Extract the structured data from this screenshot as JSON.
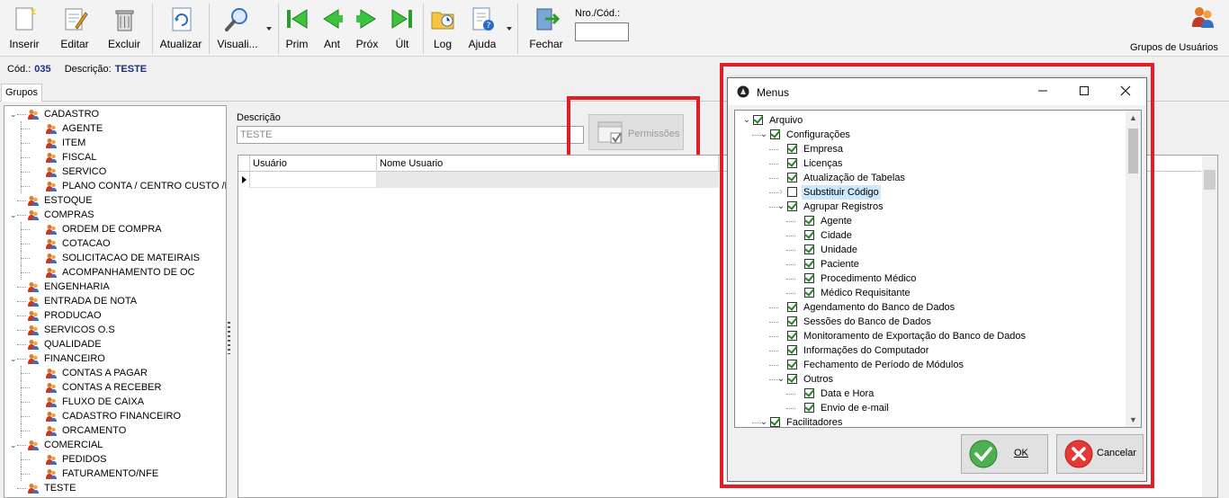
{
  "toolbar": {
    "buttons": [
      {
        "label": "Inserir",
        "icon": "new-document-icon"
      },
      {
        "label": "Editar",
        "icon": "edit-document-icon"
      },
      {
        "label": "Excluir",
        "icon": "trash-icon"
      },
      {
        "label": "Atualizar",
        "icon": "refresh-icon"
      },
      {
        "label": "Visuali...",
        "icon": "magnifier-icon"
      },
      {
        "label": "Prim",
        "icon": "first-icon"
      },
      {
        "label": "Ant",
        "icon": "previous-icon"
      },
      {
        "label": "Próx",
        "icon": "next-icon"
      },
      {
        "label": "Últ",
        "icon": "last-icon"
      },
      {
        "label": "Log",
        "icon": "log-folder-icon"
      },
      {
        "label": "Ajuda",
        "icon": "help-icon"
      },
      {
        "label": "Fechar",
        "icon": "exit-door-icon"
      }
    ],
    "nro_label": "Nro./Cód.:",
    "nro_value": "",
    "grupos_usuarios": "Grupos de Usuários"
  },
  "record": {
    "cod_label": "Cód.:",
    "cod_value": "035",
    "desc_label": "Descrição:",
    "desc_value": "TESTE"
  },
  "tab": "Grupos",
  "tree": [
    {
      "label": "CADASTRO",
      "level": 0,
      "expanded": true
    },
    {
      "label": "AGENTE",
      "level": 1
    },
    {
      "label": "ITEM",
      "level": 1
    },
    {
      "label": "FISCAL",
      "level": 1
    },
    {
      "label": "SERVICO",
      "level": 1
    },
    {
      "label": "PLANO CONTA / CENTRO CUSTO /DEF",
      "level": 1
    },
    {
      "label": "ESTOQUE",
      "level": 0
    },
    {
      "label": "COMPRAS",
      "level": 0,
      "expanded": true
    },
    {
      "label": "ORDEM DE COMPRA",
      "level": 1
    },
    {
      "label": "COTACAO",
      "level": 1
    },
    {
      "label": "SOLICITACAO DE MATEIRAIS",
      "level": 1
    },
    {
      "label": "ACOMPANHAMENTO DE OC",
      "level": 1
    },
    {
      "label": "ENGENHARIA",
      "level": 0
    },
    {
      "label": "ENTRADA DE NOTA",
      "level": 0
    },
    {
      "label": "PRODUCAO",
      "level": 0
    },
    {
      "label": "SERVICOS O.S",
      "level": 0
    },
    {
      "label": "QUALIDADE",
      "level": 0
    },
    {
      "label": "FINANCEIRO",
      "level": 0,
      "expanded": true
    },
    {
      "label": "CONTAS A PAGAR",
      "level": 1
    },
    {
      "label": "CONTAS A RECEBER",
      "level": 1
    },
    {
      "label": "FLUXO DE CAIXA",
      "level": 1
    },
    {
      "label": "CADASTRO FINANCEIRO",
      "level": 1
    },
    {
      "label": "ORCAMENTO",
      "level": 1
    },
    {
      "label": "COMERCIAL",
      "level": 0,
      "expanded": true
    },
    {
      "label": "PEDIDOS",
      "level": 1
    },
    {
      "label": "FATURAMENTO/NFE",
      "level": 1
    },
    {
      "label": "TESTE",
      "level": 0
    }
  ],
  "form": {
    "descricao_label": "Descrição",
    "descricao_value": "TESTE",
    "permissoes_label": "Permissões"
  },
  "grid": {
    "columns": [
      "Usuário",
      "Nome Usuario"
    ]
  },
  "modal": {
    "title": "Menus",
    "ok_label": "OK",
    "cancel_label": "Cancelar",
    "items": [
      {
        "label": "Arquivo",
        "level": 0,
        "exp": "v",
        "checked": true
      },
      {
        "label": "Configurações",
        "level": 1,
        "exp": "v",
        "checked": true
      },
      {
        "label": "Empresa",
        "level": 2,
        "checked": true
      },
      {
        "label": "Licenças",
        "level": 2,
        "checked": true
      },
      {
        "label": "Atualização de Tabelas",
        "level": 2,
        "checked": true
      },
      {
        "label": "Substituir Código",
        "level": 2,
        "exp": ">",
        "checked": false,
        "selected": true
      },
      {
        "label": "Agrupar Registros",
        "level": 2,
        "exp": "v",
        "checked": true
      },
      {
        "label": "Agente",
        "level": 3,
        "checked": true
      },
      {
        "label": "Cidade",
        "level": 3,
        "checked": true
      },
      {
        "label": "Unidade",
        "level": 3,
        "checked": true
      },
      {
        "label": "Paciente",
        "level": 3,
        "checked": true
      },
      {
        "label": "Procedimento Médico",
        "level": 3,
        "checked": true
      },
      {
        "label": "Médico Requisitante",
        "level": 3,
        "checked": true
      },
      {
        "label": "Agendamento do Banco de Dados",
        "level": 2,
        "checked": true
      },
      {
        "label": "Sessões do Banco de Dados",
        "level": 2,
        "checked": true
      },
      {
        "label": "Monitoramento de Exportação do Banco de Dados",
        "level": 2,
        "checked": true
      },
      {
        "label": "Informações do Computador",
        "level": 2,
        "checked": true
      },
      {
        "label": "Fechamento de Período de Módulos",
        "level": 2,
        "checked": true
      },
      {
        "label": "Outros",
        "level": 2,
        "exp": "v",
        "checked": true
      },
      {
        "label": "Data e Hora",
        "level": 3,
        "checked": true
      },
      {
        "label": "Envio de e-mail",
        "level": 3,
        "checked": true
      },
      {
        "label": "Facilitadores",
        "level": 1,
        "exp": "v",
        "checked": true
      }
    ]
  },
  "colors": {
    "highlight_red": "#e41c24",
    "code_blue": "#1c2f7c",
    "check_green": "#1e8a1e"
  }
}
